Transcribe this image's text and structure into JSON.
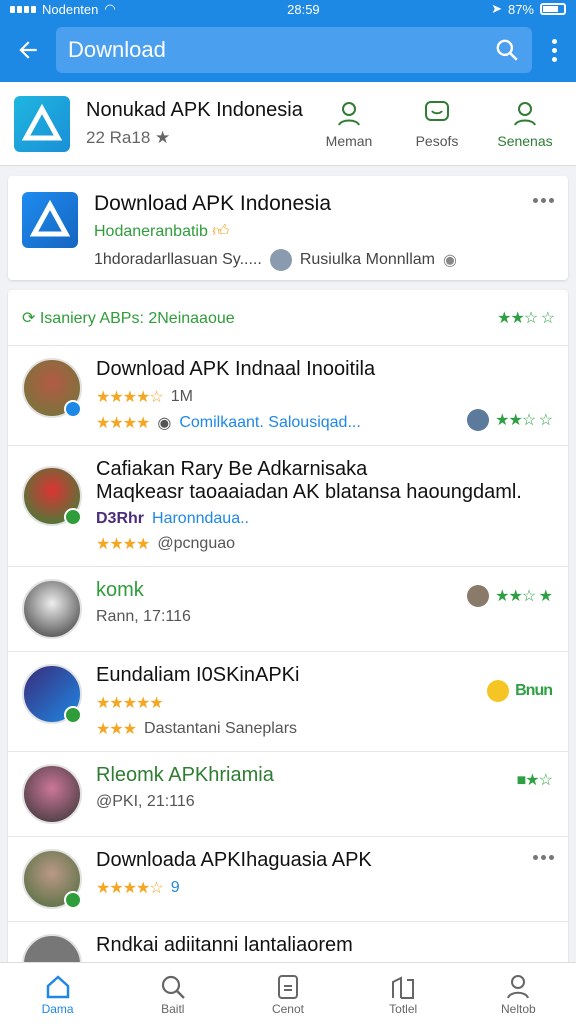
{
  "status": {
    "carrier": "Nodenten",
    "time": "28:59",
    "battery": "87%"
  },
  "search": {
    "query": "Download"
  },
  "top_card": {
    "title": "Nonukad APK Indonesia",
    "meta": "22 Ra18",
    "actions": [
      {
        "label": "Meman"
      },
      {
        "label": "Pesofs"
      },
      {
        "label": "Senenas"
      }
    ]
  },
  "feature": {
    "title": "Download APK Indonesia",
    "subtitle": "Hodaneranbatib",
    "meta": "1hdoradarllasuan Sy.....",
    "author": "Rusiulka Monnllam"
  },
  "list": {
    "header": "Isaniery ABPs: 2Neinaaoue",
    "items": [
      {
        "title": "Download APK Indnaal Inooitila",
        "sub": "1M",
        "meta": "Comilkaant. Salousiqad..."
      },
      {
        "title": "Cafiakan Rary Be Adkarnisaka",
        "title2": "Maqkeasr taoaaiadan AK blatansa haoungdaml.",
        "sub": "D3Rhr",
        "meta": "Haronndaua..",
        "meta2": "@pcnguao"
      },
      {
        "title": "komk",
        "sub": "Rann, 17:116"
      },
      {
        "title": "Eundaliam I0SKinAPKi",
        "right": "Bnun",
        "meta": "Dastantani Saneplars"
      },
      {
        "title": "Rleomk APKhriamia",
        "sub": "@PKI, 21:116"
      },
      {
        "title": "Downloada APKIhaguasia APK",
        "sub": "9"
      },
      {
        "title": "Rndkai adiitanni lantaliaorem"
      }
    ]
  },
  "nav": [
    {
      "label": "Dama"
    },
    {
      "label": "Baitl"
    },
    {
      "label": "Cenot"
    },
    {
      "label": "Totlel"
    },
    {
      "label": "Neltob"
    }
  ],
  "colors": {
    "primary": "#1e88e5",
    "green": "#2e9d3a",
    "star": "#f5a623"
  }
}
